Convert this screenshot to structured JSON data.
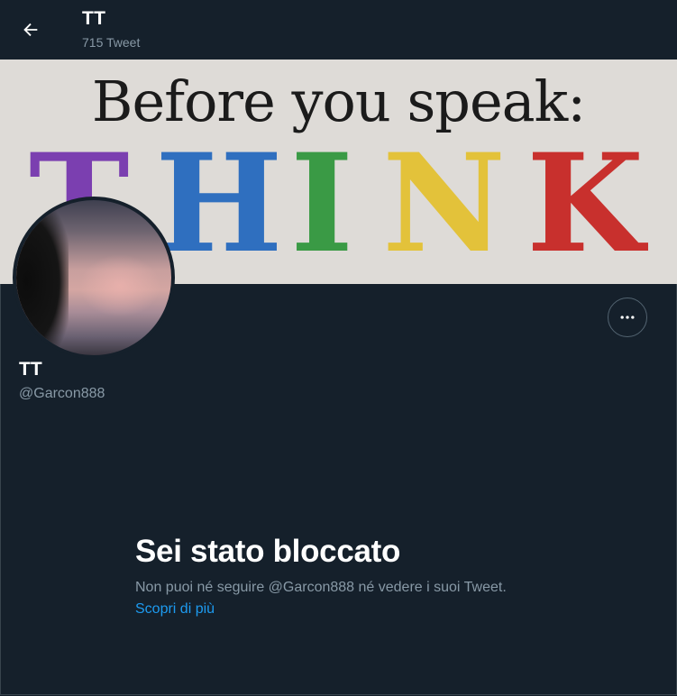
{
  "header": {
    "title": "TT",
    "tweet_count": "715 Tweet",
    "back_icon": "arrow-left-icon"
  },
  "banner": {
    "line1": "Before you speak:",
    "word": [
      "T",
      "H",
      "I",
      "N",
      "K"
    ],
    "word_colors": [
      "#7b3fb0",
      "#2f6fbf",
      "#3a9a45",
      "#e3c23a",
      "#c8302d"
    ]
  },
  "profile": {
    "name": "TT",
    "handle": "@Garcon888",
    "more_icon": "more-dots-icon"
  },
  "blocked": {
    "title": "Sei stato bloccato",
    "text": "Non puoi né seguire @Garcon888 né vedere i suoi Tweet.",
    "link": "Scopri di più"
  },
  "colors": {
    "background": "#15202b",
    "secondary_text": "#8899a6",
    "link": "#1d9bf0"
  }
}
